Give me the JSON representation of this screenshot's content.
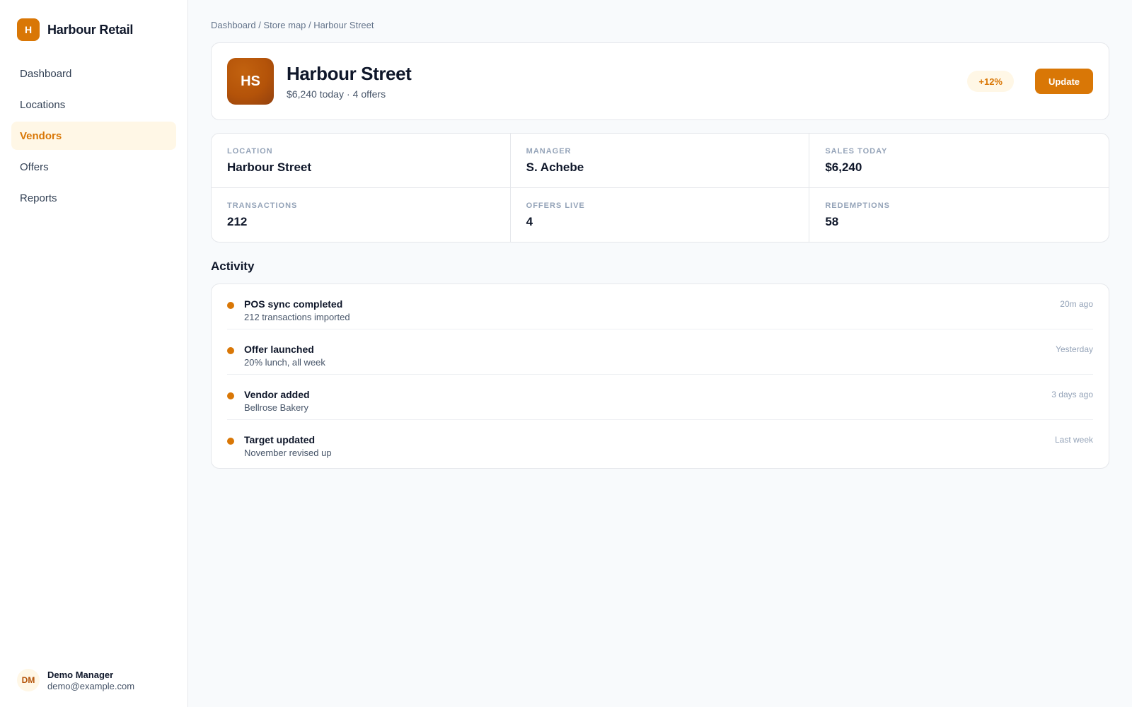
{
  "brand": {
    "logo_letter": "H",
    "name": "Harbour Retail"
  },
  "nav": {
    "items": [
      {
        "label": "Dashboard",
        "active": false
      },
      {
        "label": "Locations",
        "active": false
      },
      {
        "label": "Vendors",
        "active": true
      },
      {
        "label": "Offers",
        "active": false
      },
      {
        "label": "Reports",
        "active": false
      }
    ]
  },
  "user": {
    "initials": "DM",
    "name": "Demo Manager",
    "email": "demo@example.com"
  },
  "breadcrumb": "Dashboard / Store map / Harbour Street",
  "header": {
    "initials": "HS",
    "title": "Harbour Street",
    "sales_today": "$6,240 today",
    "separator": "·",
    "offers": "4 offers",
    "badge": "+12%",
    "update_label": "Update"
  },
  "stats": [
    {
      "label": "Location",
      "value": "Harbour Street"
    },
    {
      "label": "Manager",
      "value": "S. Achebe"
    },
    {
      "label": "Sales today",
      "value": "$6,240"
    },
    {
      "label": "Transactions",
      "value": "212"
    },
    {
      "label": "Offers live",
      "value": "4"
    },
    {
      "label": "Redemptions",
      "value": "58"
    }
  ],
  "activity": {
    "title": "Activity",
    "items": [
      {
        "title": "POS sync completed",
        "subtitle": "212 transactions imported",
        "time": "20m ago"
      },
      {
        "title": "Offer launched",
        "subtitle": "20% lunch, all week",
        "time": "Yesterday"
      },
      {
        "title": "Vendor added",
        "subtitle": "Bellrose Bakery",
        "time": "3 days ago"
      },
      {
        "title": "Target updated",
        "subtitle": "November revised up",
        "time": "Last week"
      }
    ]
  },
  "colors": {
    "accent": "#d97706",
    "accent_soft": "#fff7e6",
    "text": "#0f172a",
    "muted": "#64748b"
  }
}
